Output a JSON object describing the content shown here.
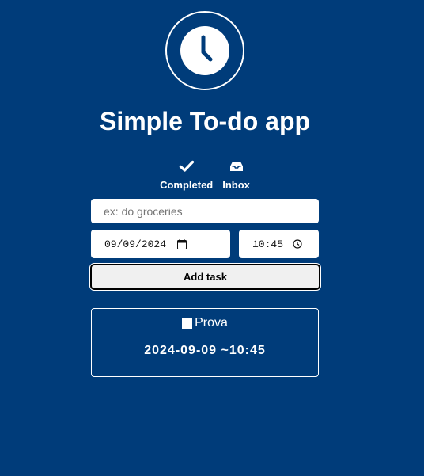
{
  "header": {
    "logo_icon": "clock-icon",
    "title": "Simple To-do app"
  },
  "nav": {
    "items": [
      {
        "label": "Completed",
        "icon": "checkmark-icon"
      },
      {
        "label": "Inbox",
        "icon": "inbox-icon"
      }
    ]
  },
  "form": {
    "task_placeholder": "ex: do groceries",
    "task_value": "",
    "date_value": "09/09/2024",
    "time_value": "10:45",
    "add_label": "Add task"
  },
  "tasks": [
    {
      "name": "Prova",
      "when": "2024-09-09 ~10:45",
      "completed": false
    }
  ],
  "colors": {
    "background": "#003c7a",
    "foreground": "#ffffff"
  }
}
